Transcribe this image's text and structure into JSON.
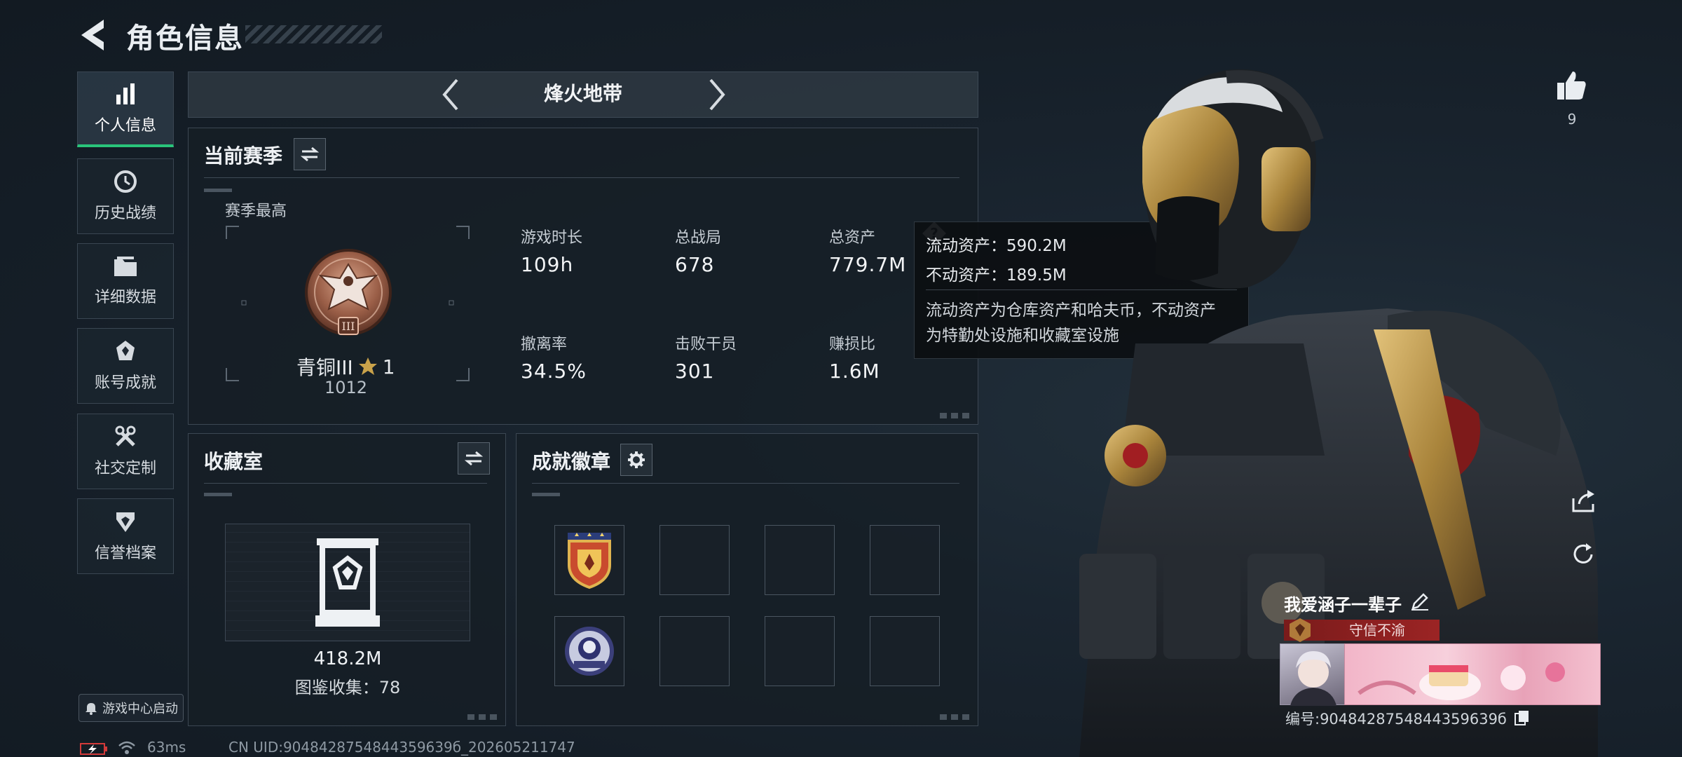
{
  "header": {
    "title": "角色信息"
  },
  "nav": [
    {
      "label": "个人信息",
      "icon": "bar-chart-icon",
      "active": true
    },
    {
      "label": "历史战绩",
      "icon": "clock-icon"
    },
    {
      "label": "详细数据",
      "icon": "folder-icon"
    },
    {
      "label": "账号成就",
      "icon": "achievement-icon"
    },
    {
      "label": "社交定制",
      "icon": "tools-icon"
    },
    {
      "label": "信誉档案",
      "icon": "shield-icon"
    }
  ],
  "mode": {
    "title": "烽火地带"
  },
  "season": {
    "title": "当前赛季",
    "best_label": "赛季最高",
    "rank_name": "青铜III",
    "rank_star": "1",
    "rank_score": "1012",
    "stats": [
      {
        "label": "游戏时长",
        "value": "109h"
      },
      {
        "label": "总战局",
        "value": "678"
      },
      {
        "label": "总资产",
        "value": "779.7M"
      },
      {
        "label": "撤离率",
        "value": "34.5%"
      },
      {
        "label": "击败干员",
        "value": "301"
      },
      {
        "label": "赚损比",
        "value": "1.6M"
      }
    ]
  },
  "tooltip": {
    "liquid": "流动资产：590.2M",
    "fixed": "不动资产：189.5M",
    "desc_line1": "流动资产为仓库资产和哈夫币，不动资产",
    "desc_line2": "为特勤处设施和收藏室设施"
  },
  "collection": {
    "title": "收藏室",
    "value": "418.2M",
    "catalog": "图鉴收集：78"
  },
  "badges": {
    "title": "成就徽章"
  },
  "like": {
    "count": "9"
  },
  "player": {
    "name": "我爱涵子一辈子",
    "reputation": "守信不渝",
    "id": "编号:9048428754844359639б"
  },
  "status": {
    "latency": "63ms",
    "uid": "CN UID:9048428754844359639б_202605211747",
    "launch": "游戏中心启动"
  },
  "colors": {
    "active_accent": "#29c47a",
    "reputation": "#9b2424",
    "gold": "#c9a24a"
  }
}
